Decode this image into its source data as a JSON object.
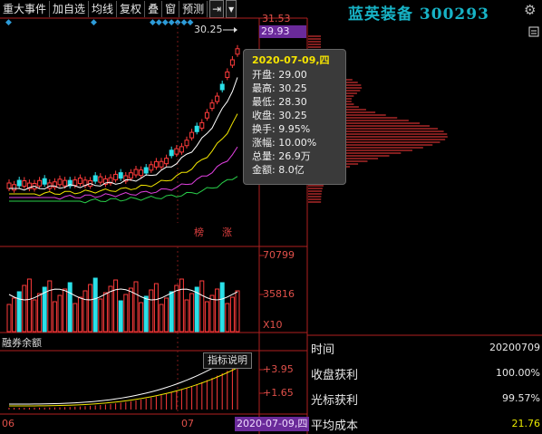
{
  "toolbar": {
    "items": [
      "重大事件",
      "加自选",
      "均线",
      "复权",
      "叠",
      "窗",
      "预测"
    ],
    "pin_icon": "pin-icon",
    "dropdown_icon": "chevron-down-icon"
  },
  "stock": {
    "name": "蓝英装备",
    "code": "300293"
  },
  "price_axis": {
    "top": "31.53",
    "current": "29.93",
    "high_label": "30.25"
  },
  "volume_axis": {
    "top": "70799",
    "mid": "35816",
    "unit": "X10"
  },
  "indicator_axis": {
    "top": "+3.95",
    "mid": "+1.65"
  },
  "badges": {
    "bang": "榜",
    "zhang": "涨"
  },
  "tooltip": {
    "date": "2020-07-09,四",
    "lines": [
      "开盘: 29.00",
      "最高: 30.25",
      "最低: 28.30",
      "收盘: 30.25",
      "换手: 9.95%",
      "涨幅: 10.00%",
      "总量: 26.9万",
      "金额: 8.0亿"
    ]
  },
  "indicator": {
    "panel_label": "融券余额",
    "help_button": "指标说明"
  },
  "x_axis": {
    "labels": [
      "06",
      "07"
    ],
    "cursor_date": "2020-07-09,四"
  },
  "chip_info": {
    "rows": [
      {
        "label": "时间",
        "value": "20200709"
      },
      {
        "label": "收盘获利",
        "value": "100.00%"
      },
      {
        "label": "光标获利",
        "value": "99.57%"
      },
      {
        "label": "平均成本",
        "value": "21.76"
      }
    ]
  },
  "colors": {
    "up": "#ff3b3b",
    "down": "#2be0e8",
    "ma5": "#ffffff",
    "ma10": "#f2e600",
    "ma20": "#e040e0",
    "ma60": "#29d04a",
    "accent": "#17b3c6"
  }
}
